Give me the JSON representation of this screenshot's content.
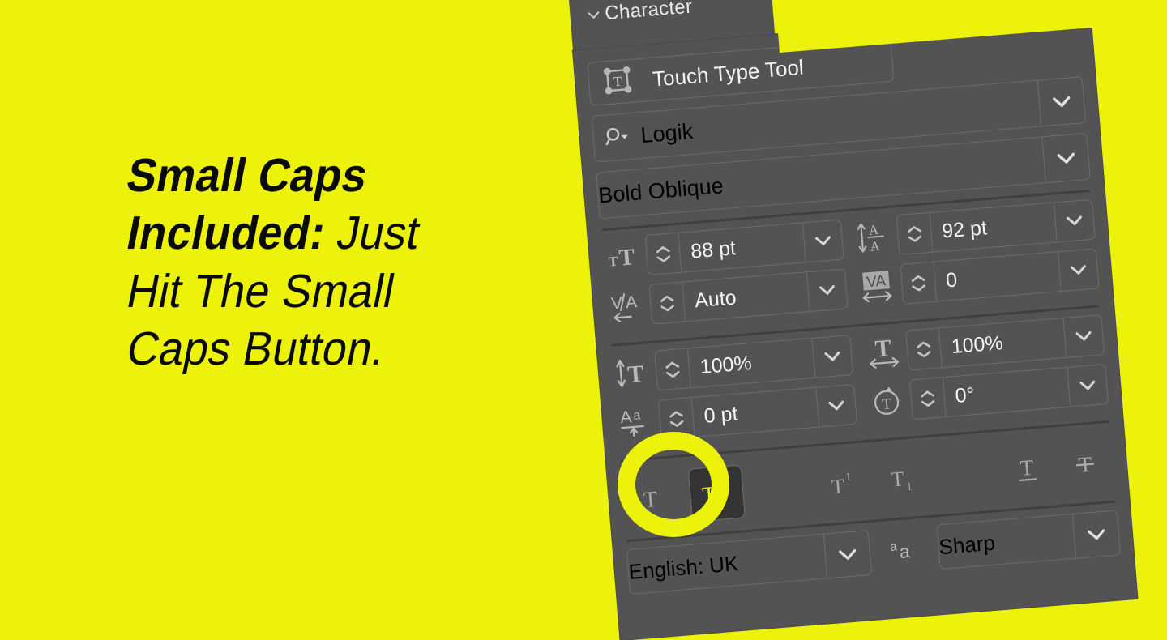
{
  "page": {
    "background_color": "#ecf209",
    "accent_color": "#ecf209",
    "panel_color": "#535353"
  },
  "specimen": {
    "line1": "Small Caps",
    "line2_heavy": "Included:",
    "line2_light": "Just",
    "line3": "Hit The Small",
    "line4": "Caps Button."
  },
  "panel": {
    "title": "Character",
    "collapse_icon": "chevron-down-icon",
    "touch_type_tool": {
      "label": "Touch Type Tool",
      "icon": "touch-type-tool-icon"
    },
    "font_family": {
      "value": "Logik",
      "icon": "font-search-icon",
      "dropdown_icon": "chevron-down-icon"
    },
    "font_style": {
      "value": "Bold Oblique",
      "dropdown_icon": "chevron-down-icon"
    },
    "fields": [
      {
        "name": "font-size",
        "icon": "font-size-icon",
        "icon_text": "TT",
        "value": "88 pt",
        "spinner": true,
        "dropdown": true
      },
      {
        "name": "leading",
        "icon": "leading-icon",
        "icon_text": "A/A",
        "value": "92 pt",
        "spinner": true,
        "dropdown": true
      },
      {
        "name": "kerning",
        "icon": "kerning-icon",
        "icon_text": "V/A",
        "value": "Auto",
        "spinner": true,
        "dropdown": true
      },
      {
        "name": "tracking",
        "icon": "tracking-icon",
        "icon_text": "VA",
        "value": "0",
        "spinner": true,
        "dropdown": true
      },
      {
        "name": "vertical-scale",
        "icon": "vertical-scale-icon",
        "icon_text": "IT",
        "value": "100%",
        "spinner": true,
        "dropdown": true
      },
      {
        "name": "horizontal-scale",
        "icon": "horizontal-scale-icon",
        "icon_text": "T",
        "value": "100%",
        "spinner": true,
        "dropdown": true
      },
      {
        "name": "baseline-shift",
        "icon": "baseline-shift-icon",
        "icon_text": "Aa",
        "value": "0 pt",
        "spinner": true,
        "dropdown": true
      },
      {
        "name": "character-rotation",
        "icon": "character-rotation-icon",
        "icon_text": "T",
        "value": "0°",
        "spinner": true,
        "dropdown": true
      }
    ],
    "style_buttons": [
      {
        "name": "all-caps",
        "glyph": "T",
        "active": false
      },
      {
        "name": "small-caps",
        "glyph": "Tᴛ",
        "active": true
      },
      {
        "name": "superscript",
        "glyph": "T¹",
        "active": false
      },
      {
        "name": "subscript",
        "glyph": "T₁",
        "active": false
      },
      {
        "name": "underline",
        "glyph": "T",
        "active": false
      },
      {
        "name": "strikethrough",
        "glyph": "T",
        "active": false
      }
    ],
    "language": {
      "value": "English: UK",
      "dropdown_icon": "chevron-down-icon"
    },
    "anti_aliasing": {
      "icon": "anti-aliasing-icon",
      "icon_text": "ᵃa",
      "value": "Sharp",
      "dropdown_icon": "chevron-down-icon"
    }
  }
}
